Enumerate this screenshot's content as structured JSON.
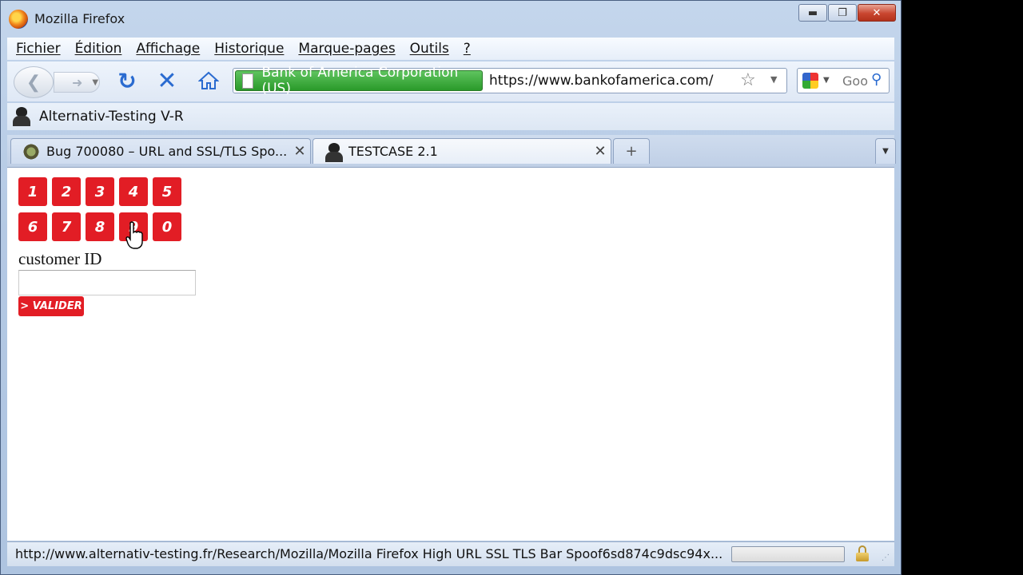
{
  "window": {
    "title": "Mozilla Firefox",
    "minimize": "▬",
    "maximize": "❐",
    "close": "✕"
  },
  "menu": [
    "Fichier",
    "Édition",
    "Affichage",
    "Historique",
    "Marque-pages",
    "Outils",
    "?"
  ],
  "nav": {
    "identity": "Bank of America Corporation (US)",
    "url": "https://www.bankofamerica.com/",
    "search_placeholder": "Goo"
  },
  "bookmarks": {
    "item": "Alternativ-Testing V-R"
  },
  "tabs": [
    {
      "label": "Bug 700080 – URL and SSL/TLS Spo...",
      "close": "✕"
    },
    {
      "label": "TESTCASE 2.1",
      "close": "✕"
    }
  ],
  "newtab": "+",
  "page": {
    "keys": [
      "1",
      "2",
      "3",
      "4",
      "5",
      "6",
      "7",
      "8",
      "9",
      "0"
    ],
    "customer_label": "customer ID",
    "customer_value": "",
    "valider": "> VALIDER"
  },
  "status": {
    "url": "http://www.alternativ-testing.fr/Research/Mozilla/Mozilla Firefox High URL SSL TLS Bar Spoof6sd874c9dsc94x..."
  },
  "colors": {
    "brand_red": "#e21d25",
    "identity_green": "#2a9a2a",
    "link_blue": "#2a6bd0"
  }
}
